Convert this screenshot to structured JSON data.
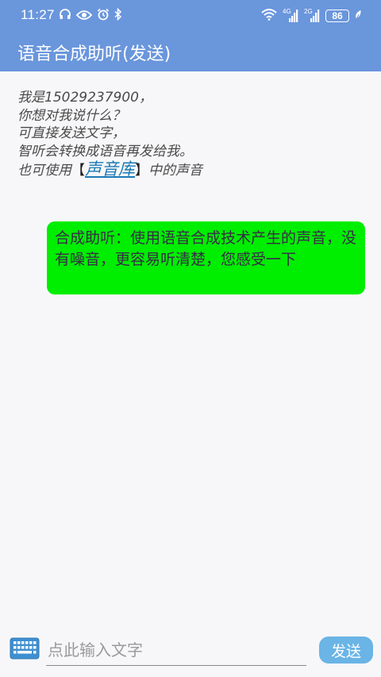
{
  "status_bar": {
    "time": "11:27",
    "left_icons": [
      "headphones-icon",
      "eye-icon",
      "alarm-icon",
      "bluetooth-icon"
    ],
    "right_icons": [
      "wifi-icon",
      "signal-4g-icon",
      "signal-2g-icon"
    ],
    "network_1": "4G",
    "network_2": "2G",
    "battery_level": "86"
  },
  "app_bar": {
    "title": "语音合成助听(发送)"
  },
  "intro": {
    "line1": "我是15029237900，",
    "line2": "你想对我说什么？",
    "line3": "可直接发送文字，",
    "line4": "智听会转换成语音再发给我。",
    "line5_prefix": "也可使用",
    "bracket_open": "【",
    "link": "声音库",
    "bracket_close": "】",
    "line5_suffix": "中的声音"
  },
  "message": {
    "text": "合成助听：使用语音合成技术产生的声音，没有噪音，更容易听清楚，您感受一下"
  },
  "input_bar": {
    "placeholder": "点此输入文字",
    "value": "",
    "send_label": "发送",
    "keyboard_icon": "keyboard-icon"
  },
  "colors": {
    "app_bar": "#6a96dc",
    "bubble": "#00ee00",
    "link": "#1a79b5",
    "send_button": "#6ab4e6",
    "background": "#f7f7f9"
  }
}
